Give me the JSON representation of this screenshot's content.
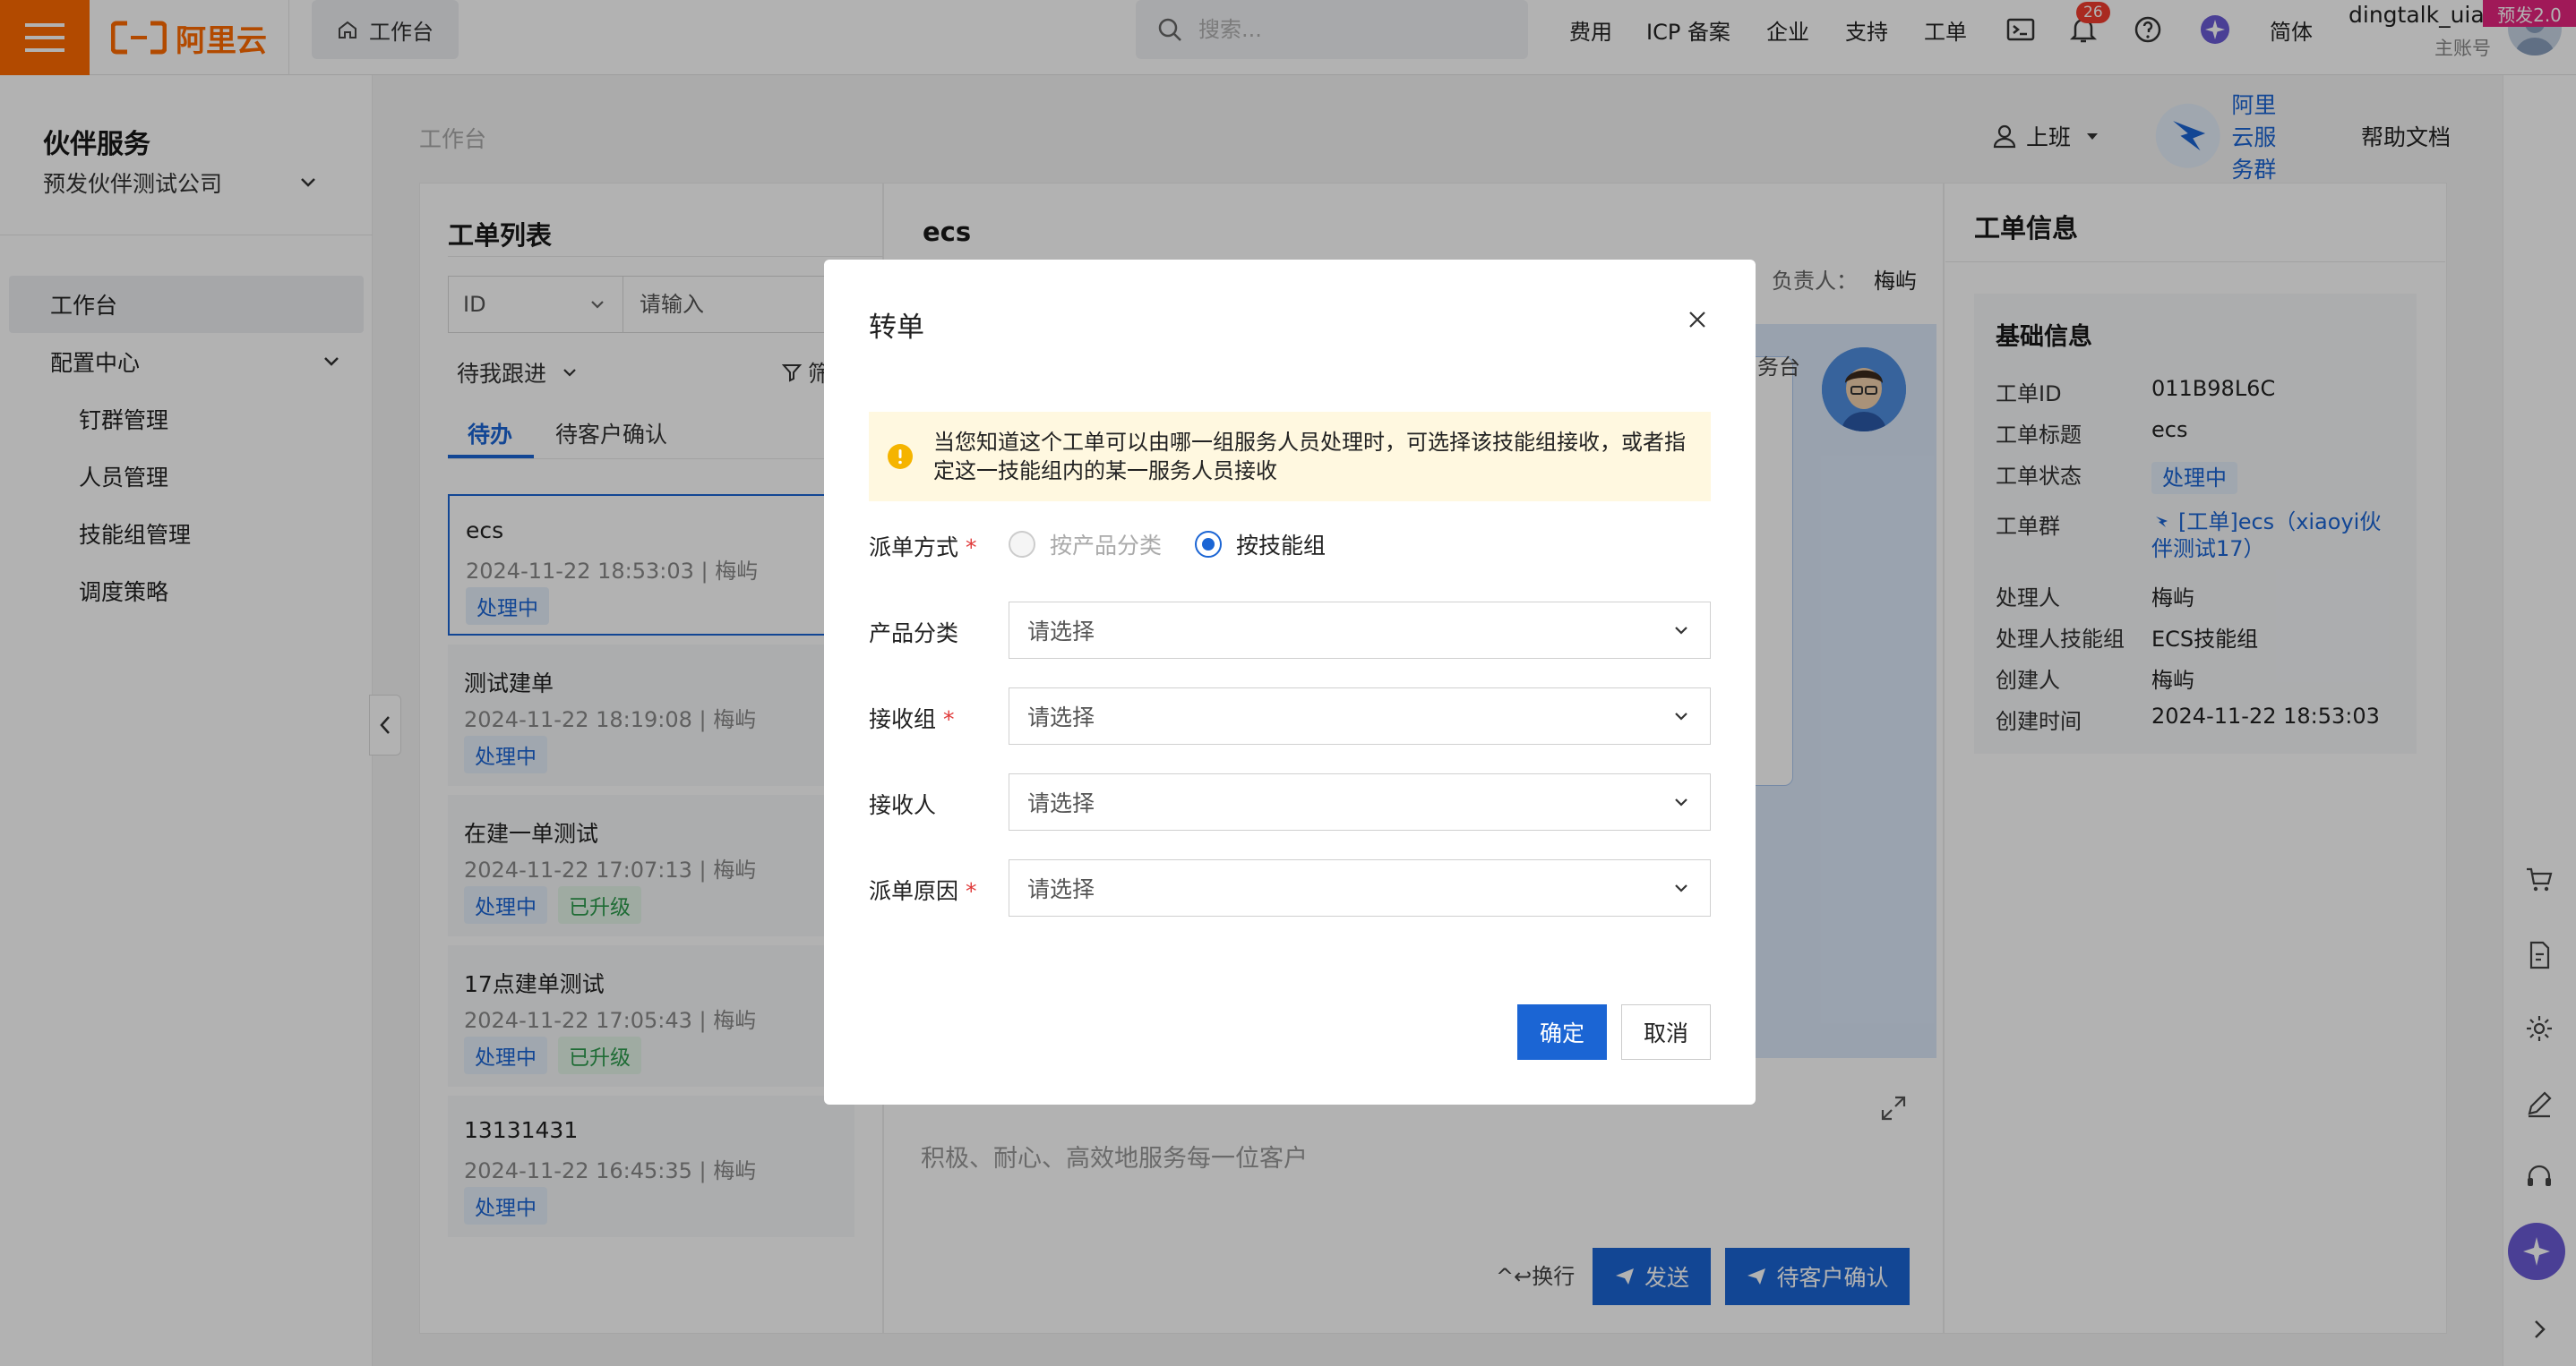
{
  "topbar": {
    "logo_text": "阿里云",
    "workbench_tab": "工作台",
    "search_placeholder": "搜索...",
    "nav": [
      "费用",
      "ICP 备案",
      "企业",
      "支持",
      "工单"
    ],
    "notification_count": "26",
    "language": "简体",
    "user_name": "dingtalk_uia...",
    "user_role": "主账号",
    "env_badge": "预发2.0",
    "brand_color": "#ff6a00"
  },
  "sidebar": {
    "title": "伙伴服务",
    "company": "预发伙伴测试公司",
    "items": [
      {
        "label": "工作台",
        "active": true
      },
      {
        "label": "配置中心",
        "expanded": true
      },
      {
        "label": "钉群管理"
      },
      {
        "label": "人员管理"
      },
      {
        "label": "技能组管理"
      },
      {
        "label": "调度策略"
      }
    ]
  },
  "header": {
    "breadcrumb": "工作台",
    "status": "上班",
    "service_group": "阿里云服务群",
    "help": "帮助文档"
  },
  "ticket_list": {
    "title": "工单列表",
    "id_select": "ID",
    "keyword_placeholder": "请输入",
    "follow_filter": "待我跟进",
    "filter_label": "筛",
    "tabs": [
      "待办",
      "待客户确认"
    ],
    "cards": [
      {
        "title": "ecs",
        "time": "2024-11-22 18:53:03",
        "owner": "梅屿",
        "status": "处理中",
        "extra": ""
      },
      {
        "title": "测试建单",
        "time": "2024-11-22 18:19:08",
        "owner": "梅屿",
        "status": "处理中",
        "extra": ""
      },
      {
        "title": "在建一单测试",
        "time": "2024-11-22 17:07:13",
        "owner": "梅屿",
        "status": "处理中",
        "extra": "已升级"
      },
      {
        "title": "17点建单测试",
        "time": "2024-11-22 17:05:43",
        "owner": "梅屿",
        "status": "处理中",
        "extra": "已升级"
      },
      {
        "title": "13131431",
        "time": "2024-11-22 16:45:35",
        "owner": "梅屿",
        "status": "处理中",
        "extra": ""
      }
    ]
  },
  "conversation": {
    "title": "ecs",
    "owner_label": "负责人：",
    "owner": "梅屿",
    "workspace_fragment": "务台",
    "input_placeholder": "积极、耐心、高效地服务每一位客户",
    "newline_hint": "^↩换行",
    "send": "发送",
    "await_confirm": "待客户确认"
  },
  "ticket_info": {
    "title": "工单信息",
    "section": "基础信息",
    "fields": [
      {
        "key": "工单ID",
        "value": "011B98L6C"
      },
      {
        "key": "工单标题",
        "value": "ecs"
      },
      {
        "key": "工单状态",
        "value": "处理中"
      },
      {
        "key": "工单群",
        "value": "[工单]ecs（xiaoyi伙伴测试17）"
      },
      {
        "key": "处理人",
        "value": "梅屿"
      },
      {
        "key": "处理人技能组",
        "value": "ECS技能组"
      },
      {
        "key": "创建人",
        "value": "梅屿"
      },
      {
        "key": "创建时间",
        "value": "2024-11-22 18:53:03"
      }
    ]
  },
  "modal": {
    "title": "转单",
    "alert": "当您知道这个工单可以由哪一组服务人员处理时，可选择该技能组接收，或者指定这一技能组内的某一服务人员接收",
    "fields": {
      "dispatch_mode": {
        "label": "派单方式",
        "options": [
          "按产品分类",
          "按技能组"
        ],
        "selected": "按技能组"
      },
      "product_category": {
        "label": "产品分类",
        "placeholder": "请选择"
      },
      "receiving_group": {
        "label": "接收组",
        "placeholder": "请选择"
      },
      "receiver": {
        "label": "接收人",
        "placeholder": "请选择"
      },
      "dispatch_reason": {
        "label": "派单原因",
        "placeholder": "请选择"
      }
    },
    "ok": "确定",
    "cancel": "取消",
    "primary_color": "#1b65d4"
  }
}
